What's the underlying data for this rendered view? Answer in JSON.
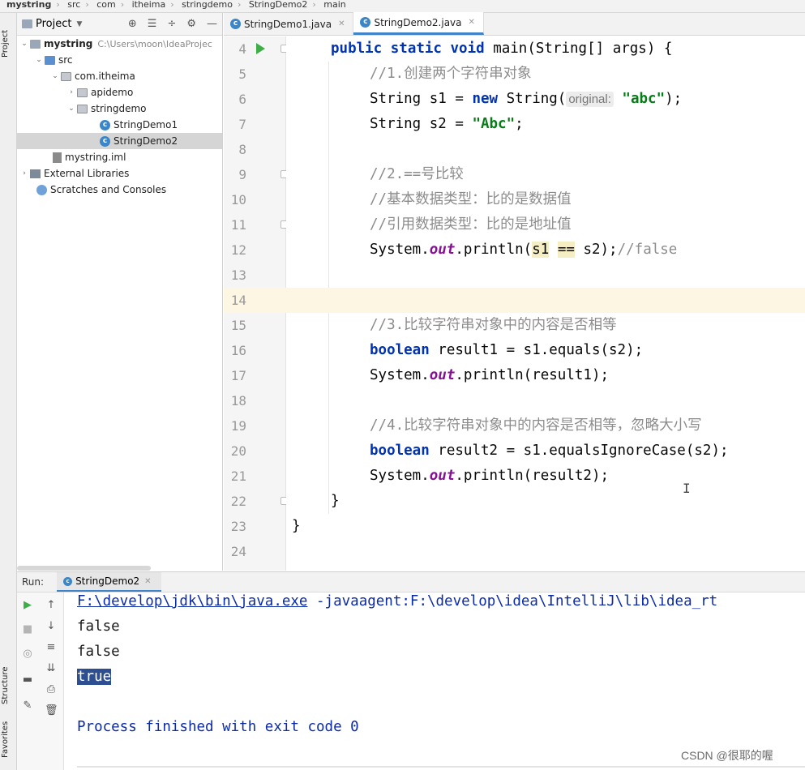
{
  "breadcrumb": [
    "mystring",
    "src",
    "com",
    "itheima",
    "stringdemo",
    "StringDemo2",
    "main"
  ],
  "left_tabs": {
    "project": "Project",
    "structure": "Structure",
    "favorites": "Favorites"
  },
  "project_panel": {
    "title": "Project",
    "tree": [
      {
        "label": "mystring",
        "path": "C:\\Users\\moon\\IdeaProjec",
        "icon": "module-folder-icon"
      },
      {
        "label": "src",
        "icon": "source-folder-icon"
      },
      {
        "label": "com.itheima",
        "icon": "package-icon"
      },
      {
        "label": "apidemo",
        "icon": "package-icon"
      },
      {
        "label": "stringdemo",
        "icon": "package-icon"
      },
      {
        "label": "StringDemo1",
        "icon": "java-class-icon"
      },
      {
        "label": "StringDemo2",
        "icon": "java-class-icon",
        "selected": true
      },
      {
        "label": "mystring.iml",
        "icon": "iml-file-icon"
      },
      {
        "label": "External Libraries",
        "icon": "library-icon"
      },
      {
        "label": "Scratches and Consoles",
        "icon": "scratches-icon"
      }
    ]
  },
  "editor_tabs": [
    {
      "label": "StringDemo1.java",
      "active": false
    },
    {
      "label": "StringDemo2.java",
      "active": true
    }
  ],
  "line_numbers": [
    "4",
    "5",
    "6",
    "7",
    "8",
    "9",
    "10",
    "11",
    "12",
    "13",
    "14",
    "15",
    "16",
    "17",
    "18",
    "19",
    "20",
    "21",
    "22",
    "23",
    "24"
  ],
  "current_line": "14",
  "code": {
    "l4": {
      "a": "public static void ",
      "b": "main(String[] args) {"
    },
    "l5": "//1.创建两个字符串对象",
    "l6": {
      "a": "String s1 = ",
      "b": "new",
      "c": " String(",
      "hint": "original:",
      "d": "\"abc\"",
      "e": ");"
    },
    "l7": {
      "a": "String s2 = ",
      "b": "\"Abc\"",
      "c": ";"
    },
    "l9": "//2.==号比较",
    "l10": "//基本数据类型：比的是数据值",
    "l11": "//引用数据类型：比的是地址值",
    "l12": {
      "a": "System.",
      "b": "out",
      "c": ".println(",
      "d": "s1",
      "e": " ",
      "f": "==",
      "g": " s2);",
      "h": "//false"
    },
    "l15": "//3.比较字符串对象中的内容是否相等",
    "l16": {
      "a": "boolean",
      "b": " result1 = s1.equals(s2);"
    },
    "l17": {
      "a": "System.",
      "b": "out",
      "c": ".println(result1);"
    },
    "l19": "//4.比较字符串对象中的内容是否相等，忽略大小写",
    "l20": {
      "a": "boolean",
      "b": " result2 = s1.equalsIgnoreCase(s2);"
    },
    "l21": {
      "a": "System.",
      "b": "out",
      "c": ".println(result2);"
    },
    "l22": "}",
    "l23": "}"
  },
  "run_panel": {
    "label": "Run:",
    "tab": "StringDemo2",
    "command_path": "F:\\develop\\jdk\\bin\\java.exe",
    "command_rest": " -javaagent:F:\\develop\\idea\\IntelliJ\\lib\\idea_rt",
    "output": [
      "false",
      "false",
      "true"
    ],
    "exit_message": "Process finished with exit code 0"
  },
  "watermark": "CSDN @很耶的喔",
  "colors": {
    "keyword": "#0033b3",
    "comment": "#8c8c8c",
    "string": "#067d17",
    "static_field": "#871094",
    "run_green": "#3fae48",
    "selection": "#2d4f91"
  }
}
